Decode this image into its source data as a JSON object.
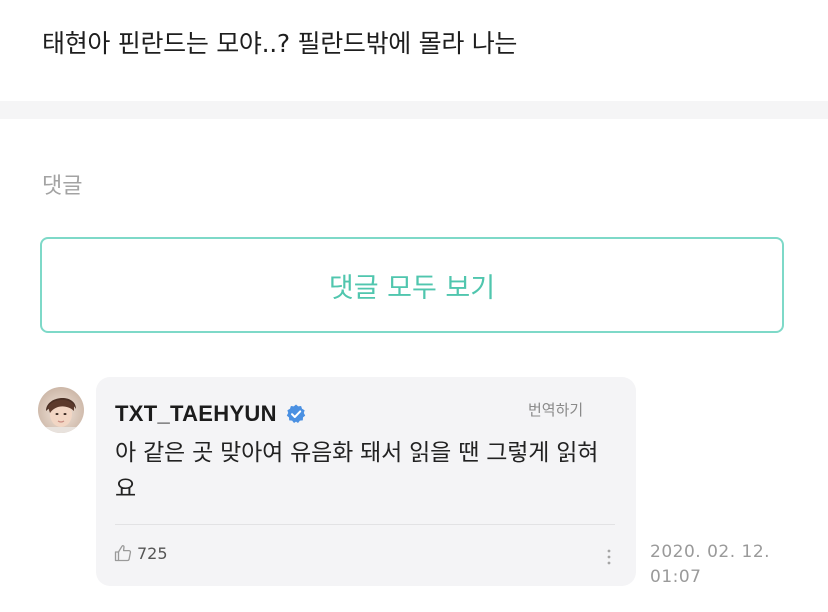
{
  "post": {
    "text": "태현아 핀란드는 모야..? 필란드밖에 몰라 나는"
  },
  "comments_section": {
    "label": "댓글",
    "view_all_label": "댓글 모두 보기"
  },
  "comment": {
    "author": "TXT_TAEHYUN",
    "verified_icon": "verified-check-icon",
    "translate_label": "번역하기",
    "text": "아 같은 곳 맞아여 유음화 돼서 읽을 땐 그렇게 읽혀요",
    "like_icon": "thumbs-up-icon",
    "likes": "725",
    "more_icon": "vertical-dots-icon",
    "date": "2020. 02. 12.",
    "time": "01:07"
  },
  "colors": {
    "accent": "#50c6ae",
    "accent_border": "#7ed9c8",
    "verified": "#4a90e2",
    "bubble_bg": "#f4f4f6"
  }
}
